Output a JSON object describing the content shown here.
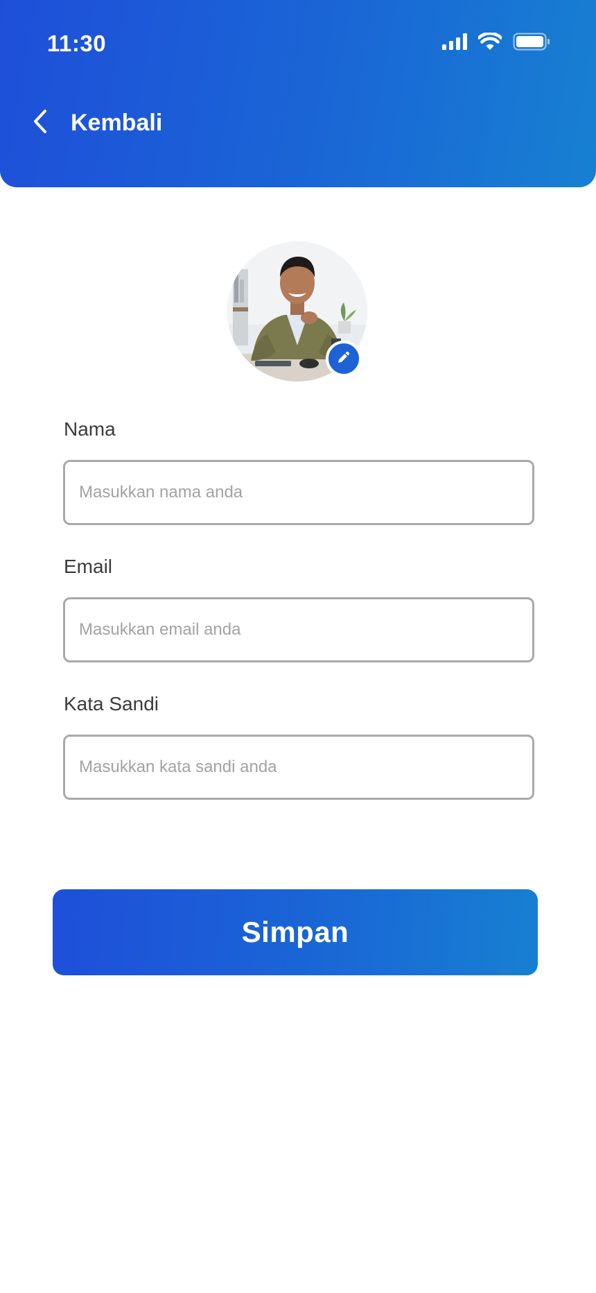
{
  "status_bar": {
    "time": "11:30",
    "icons": [
      "signal-icon",
      "wifi-icon",
      "battery-icon"
    ]
  },
  "nav": {
    "back_icon": "chevron-left-icon",
    "title": "Kembali"
  },
  "profile": {
    "edit_icon": "pencil-icon"
  },
  "form": {
    "name": {
      "label": "Nama",
      "value": "",
      "placeholder": "Masukkan nama anda"
    },
    "email": {
      "label": "Email",
      "value": "",
      "placeholder": "Masukkan email anda"
    },
    "password": {
      "label": "Kata Sandi",
      "value": "",
      "placeholder": "Masukkan kata sandi anda"
    }
  },
  "actions": {
    "save_label": "Simpan"
  },
  "colors": {
    "primary_start": "#1e4fd9",
    "primary_end": "#1780d2",
    "input_border": "#a9a9a9",
    "label_text": "#3b3b3b",
    "placeholder_text": "#a2a2a2"
  }
}
